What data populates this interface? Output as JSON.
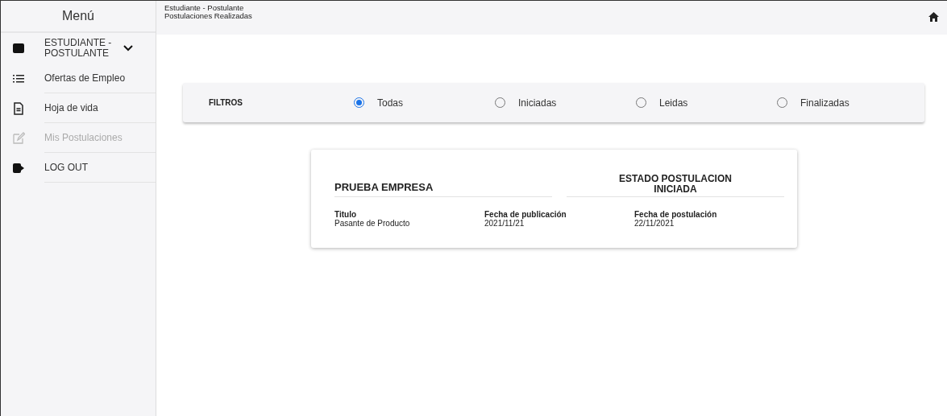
{
  "sidebar": {
    "title": "Menú",
    "items": [
      {
        "kind": "profile",
        "label": "ESTUDIANTE - POSTULANTE",
        "disabled": false
      },
      {
        "kind": "list",
        "label": "Ofertas de Empleo",
        "disabled": false
      },
      {
        "kind": "document",
        "label": "Hoja de vida",
        "disabled": false
      },
      {
        "kind": "edit",
        "label": "Mis Postulaciones",
        "disabled": true
      },
      {
        "kind": "logout",
        "label": "LOG OUT",
        "disabled": false
      }
    ]
  },
  "header": {
    "breadcrumb": [
      "Estudiante - Postulante",
      "Postulaciones Realizadas"
    ]
  },
  "filters": {
    "label": "FILTROS",
    "options": [
      {
        "label": "Todas",
        "selected": true
      },
      {
        "label": "Iniciadas",
        "selected": false
      },
      {
        "label": "Leidas",
        "selected": false
      },
      {
        "label": "Finalizadas",
        "selected": false
      }
    ]
  },
  "applications": [
    {
      "company": "PRUEBA EMPRESA",
      "status_title": "ESTADO POSTULACION",
      "status": "INICIADA",
      "fields": [
        {
          "label": "Titulo",
          "value": "Pasante de Producto"
        },
        {
          "label": "Fecha de publicación",
          "value": "2021/11/21"
        },
        {
          "label": "Fecha de postulación",
          "value": "22/11/2021"
        }
      ]
    }
  ]
}
